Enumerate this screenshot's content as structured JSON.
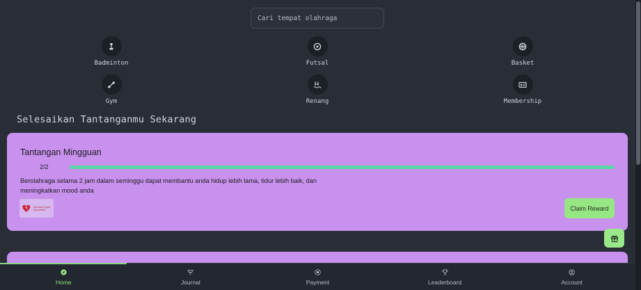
{
  "search": {
    "placeholder": "Cari tempat olahraga"
  },
  "categories": [
    {
      "label": "Badminton",
      "icon": "badminton-icon"
    },
    {
      "label": "Futsal",
      "icon": "soccer-ball-icon"
    },
    {
      "label": "Basket",
      "icon": "basketball-icon"
    },
    {
      "label": "Gym",
      "icon": "dumbbell-icon"
    },
    {
      "label": "Renang",
      "icon": "swimming-icon"
    },
    {
      "label": "Membership",
      "icon": "id-card-icon"
    }
  ],
  "section_title": "Selesaikan Tantanganmu Sekarang",
  "challenge": {
    "title": "Tantangan Mingguan",
    "progress_label": "2/2",
    "progress_fraction": 1.0,
    "description": "Berolahraga selama 2 jam dalam seminggu dapat membantu anda hidup lebih lama, tidur lebih baik, dan meningkatkan mood anda",
    "logo_text": "American Heart Association",
    "claim_label": "Claim Reward"
  },
  "colors": {
    "background": "#282d36",
    "card": "#c891ed",
    "progress": "#58d6a4",
    "accent_green": "#97e684"
  },
  "nav": {
    "items": [
      {
        "label": "Home",
        "icon": "compass-icon",
        "active": true
      },
      {
        "label": "Journal",
        "icon": "journal-icon",
        "active": false
      },
      {
        "label": "Payment",
        "icon": "payment-icon",
        "active": false
      },
      {
        "label": "Leaderboard",
        "icon": "trophy-icon",
        "active": false
      },
      {
        "label": "Account",
        "icon": "account-icon",
        "active": false
      }
    ]
  }
}
